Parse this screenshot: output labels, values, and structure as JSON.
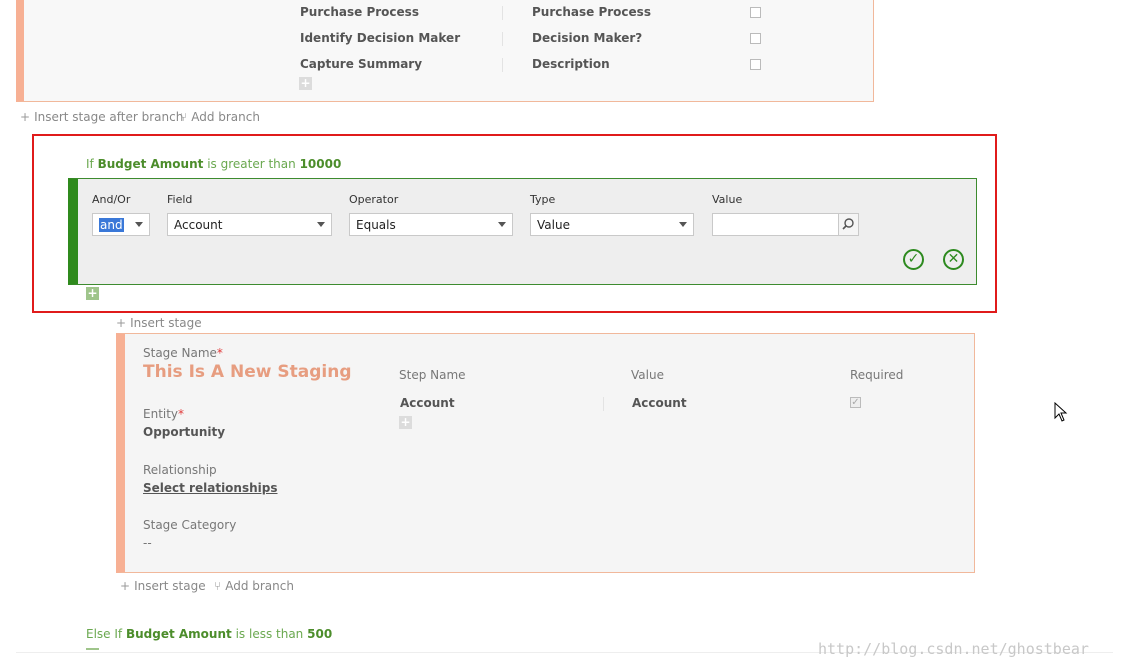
{
  "top_stage": {
    "steps": [
      {
        "name": "Purchase Process",
        "field": "Purchase Process"
      },
      {
        "name": "Identify Decision Maker",
        "field": "Decision Maker?"
      },
      {
        "name": "Capture Summary",
        "field": "Description"
      }
    ]
  },
  "top_actions": {
    "insert_stage_after_branch": "Insert stage after branch",
    "add_branch": "Add branch"
  },
  "condition": {
    "prefix": "If",
    "field": "Budget Amount",
    "operator_text": "is greater than",
    "value": "10000"
  },
  "rule_editor": {
    "labels": {
      "and_or": "And/Or",
      "field": "Field",
      "operator": "Operator",
      "type": "Type",
      "value": "Value"
    },
    "and_or_value": "and",
    "field_value": "Account",
    "operator_value": "Equals",
    "type_value": "Value",
    "value_input": ""
  },
  "insert_stage_1": "Insert stage",
  "stage": {
    "stage_name_label": "Stage Name",
    "stage_name": "This Is A New Staging",
    "entity_label": "Entity",
    "entity_value": "Opportunity",
    "relationship_label": "Relationship",
    "relationship_value": "Select relationships",
    "category_label": "Stage Category",
    "category_value": "--",
    "col_step_name": "Step Name",
    "col_value": "Value",
    "col_required": "Required",
    "step_name": "Account",
    "step_value": "Account"
  },
  "bottom_actions": {
    "insert_stage": "Insert stage",
    "add_branch": "Add branch"
  },
  "else_condition": {
    "prefix": "Else If",
    "field": "Budget Amount",
    "operator_text": "is less than",
    "value": "500"
  },
  "watermark": "http://blog.csdn.net/ghostbear",
  "colors": {
    "stage_accent": "#f7b094",
    "condition_green": "#2f8a1d",
    "highlight_red": "#e01b1b"
  }
}
